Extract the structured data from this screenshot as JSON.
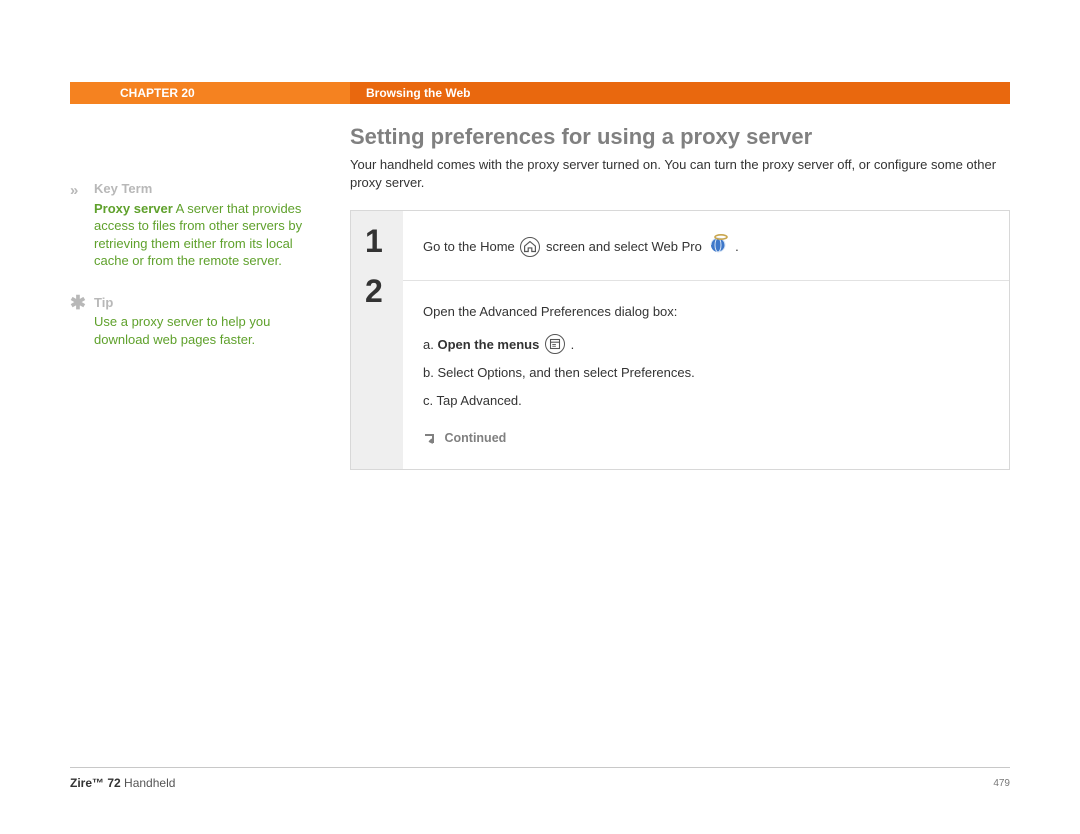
{
  "header": {
    "chapter": "CHAPTER 20",
    "title": "Browsing the Web"
  },
  "sidebar": {
    "keyterm": {
      "label": "Key Term",
      "term": "Proxy server",
      "text": " A server that provides access to files from other servers by retrieving them either from its local cache or from the remote server."
    },
    "tip": {
      "label": "Tip",
      "text": "Use a proxy server to help you download web pages faster."
    }
  },
  "main": {
    "heading": "Setting preferences for using a proxy server",
    "intro": "Your handheld comes with the proxy server turned on. You can turn the proxy server off, or configure some other proxy server.",
    "steps": {
      "nums": [
        "1",
        "2"
      ],
      "step1": {
        "pre": "Go to the Home ",
        "mid": " screen and select Web Pro ",
        "post": " ."
      },
      "step2": {
        "lead": "Open the Advanced Preferences dialog box:",
        "a_prefix": "a.  ",
        "a_bold": "Open the menus",
        "a_post": " .",
        "b": "b.  Select Options, and then select Preferences.",
        "c": "c.  Tap Advanced."
      },
      "continued": "Continued"
    }
  },
  "footer": {
    "product_bold": "Zire™ 72",
    "product_rest": " Handheld",
    "page": "479"
  }
}
